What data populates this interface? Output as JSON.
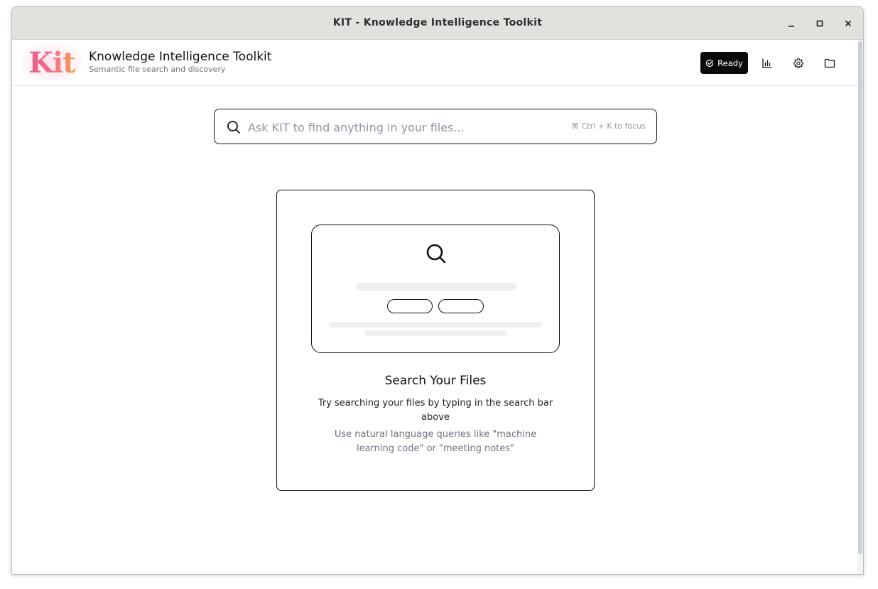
{
  "window": {
    "title": "KIT - Knowledge Intelligence Toolkit",
    "controls": [
      "minimize",
      "maximize",
      "close"
    ]
  },
  "header": {
    "logo_text": "Kit",
    "title": "Knowledge Intelligence Toolkit",
    "subtitle": "Semantic file search and discovery",
    "status_label": "Ready",
    "icons": [
      "bar-chart-icon",
      "gear-icon",
      "folder-icon"
    ]
  },
  "search": {
    "placeholder": "Ask KIT to find anything in your files...",
    "value": "",
    "shortcut_hint": "⌘ Ctrl + K to focus"
  },
  "empty_state": {
    "title": "Search Your Files",
    "description": "Try searching your files by typing in the search bar above",
    "hint": "Use natural language queries like \"machine learning code\" or \"meeting notes\""
  },
  "colors": {
    "accent_dark": "#0a0a0a",
    "logo_gradient_start": "#ef5a8a",
    "logo_gradient_end": "#f49a55",
    "muted_text": "#6b7280"
  }
}
